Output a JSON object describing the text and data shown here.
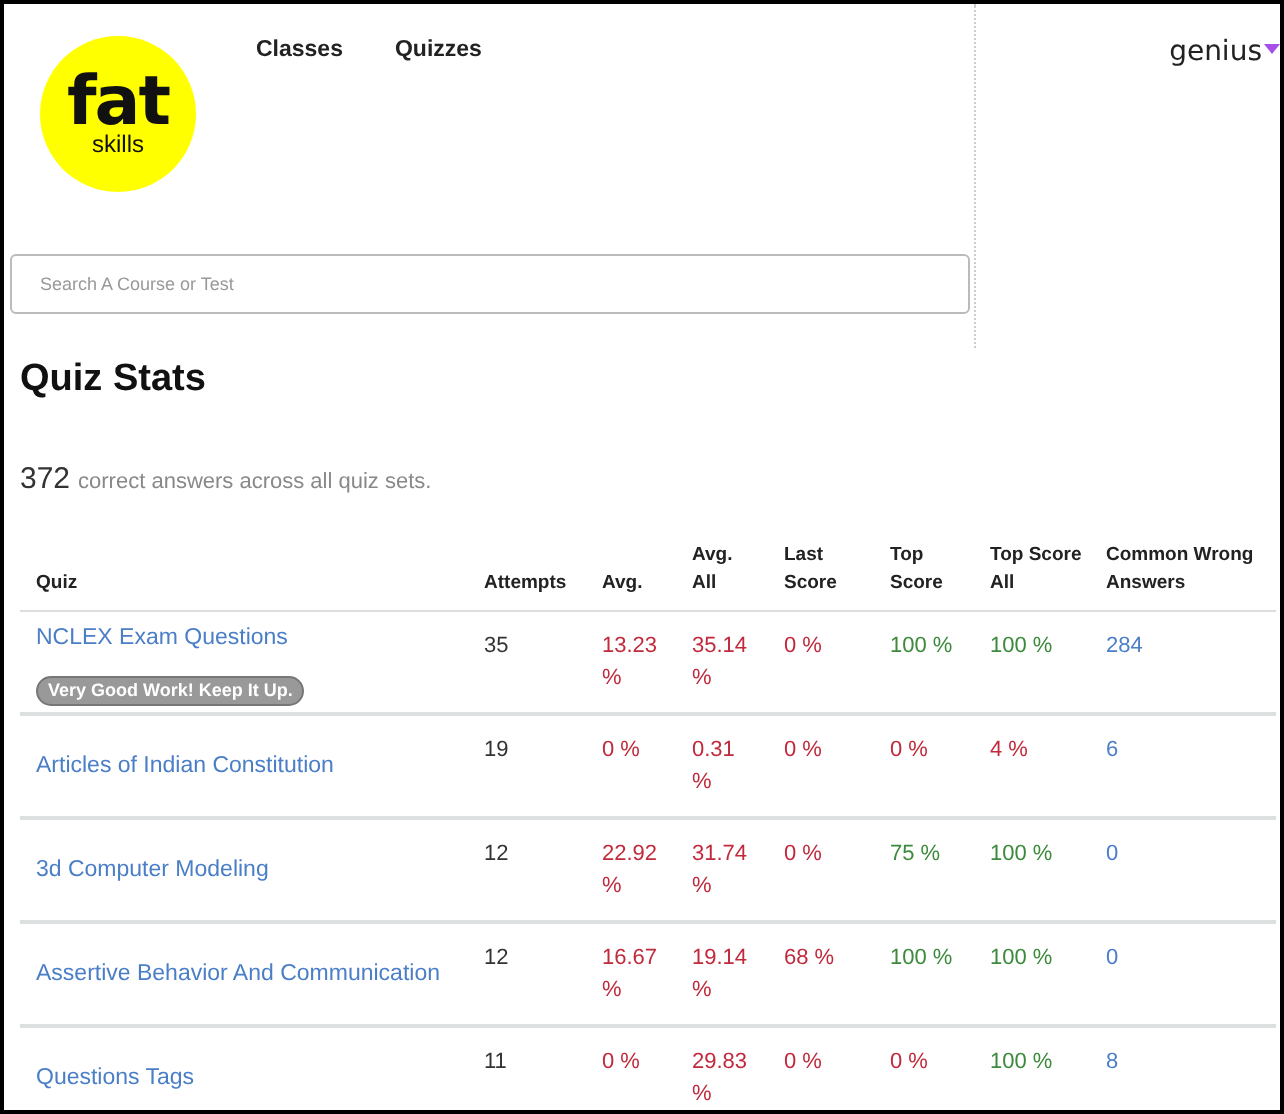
{
  "logo": {
    "top": "fat",
    "bottom": "skills"
  },
  "nav": [
    "Classes",
    "Quizzes"
  ],
  "user": {
    "name": "genius"
  },
  "search": {
    "placeholder": "Search A Course or Test"
  },
  "title": "Quiz Stats",
  "summary": {
    "count": "372",
    "text": "correct answers across all quiz sets."
  },
  "table": {
    "columns": [
      "Quiz",
      "Attempts",
      "Avg.",
      "Avg. All",
      "Last Score",
      "Top Score",
      "Top Score All",
      "Common Wrong Answers"
    ],
    "rows": [
      {
        "quiz": "NCLEX Exam Questions",
        "badge": "Very Good Work! Keep It Up.",
        "attempts": "35",
        "metrics": [
          {
            "text": "13.23 %",
            "kind": "low"
          },
          {
            "text": "35.14 %",
            "kind": "low"
          },
          {
            "text": "0 %",
            "kind": "low"
          },
          {
            "text": "100 %",
            "kind": "high"
          },
          {
            "text": "100 %",
            "kind": "high"
          }
        ],
        "wrong": "284"
      },
      {
        "quiz": "Articles of Indian Constitution",
        "attempts": "19",
        "metrics": [
          {
            "text": "0 %",
            "kind": "low"
          },
          {
            "text": "0.31 %",
            "kind": "low"
          },
          {
            "text": "0 %",
            "kind": "low"
          },
          {
            "text": "0 %",
            "kind": "low"
          },
          {
            "text": "4 %",
            "kind": "low"
          }
        ],
        "wrong": "6"
      },
      {
        "quiz": "3d Computer Modeling",
        "attempts": "12",
        "metrics": [
          {
            "text": "22.92 %",
            "kind": "low"
          },
          {
            "text": "31.74 %",
            "kind": "low"
          },
          {
            "text": "0 %",
            "kind": "low"
          },
          {
            "text": "75 %",
            "kind": "high"
          },
          {
            "text": "100 %",
            "kind": "high"
          }
        ],
        "wrong": "0"
      },
      {
        "quiz": "Assertive Behavior And Communication",
        "attempts": "12",
        "metrics": [
          {
            "text": "16.67 %",
            "kind": "low"
          },
          {
            "text": "19.14 %",
            "kind": "low"
          },
          {
            "text": "68 %",
            "kind": "low"
          },
          {
            "text": "100 %",
            "kind": "high"
          },
          {
            "text": "100 %",
            "kind": "high"
          }
        ],
        "wrong": "0"
      },
      {
        "quiz": "Questions Tags",
        "attempts": "11",
        "metrics": [
          {
            "text": "0 %",
            "kind": "low"
          },
          {
            "text": "29.83 %",
            "kind": "low"
          },
          {
            "text": "0 %",
            "kind": "low"
          },
          {
            "text": "0 %",
            "kind": "low"
          },
          {
            "text": "100 %",
            "kind": "high"
          }
        ],
        "wrong": "8"
      }
    ]
  }
}
